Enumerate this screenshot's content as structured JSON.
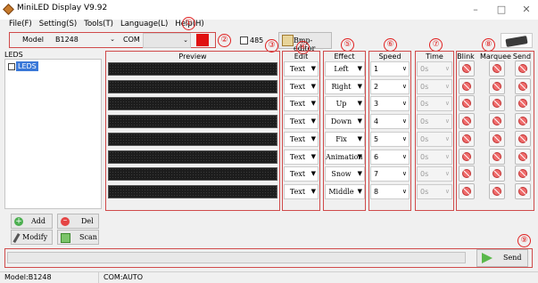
{
  "window": {
    "title": "MiniLED Display V9.92",
    "minimize": "–",
    "maximize": "□",
    "close": "✕"
  },
  "menu": [
    "File(F)",
    "Setting(S)",
    "Tools(T)",
    "Language(L)",
    "Help(H)"
  ],
  "toolbar": {
    "model_label": "Model",
    "model_value": "B1248",
    "com_label": "COM",
    "com_value": "",
    "check485_label": "485",
    "bmp_editor_label": "Bmp-editor"
  },
  "markers": [
    "①",
    "②",
    "③",
    "④",
    "⑤",
    "⑥",
    "⑦",
    "⑧",
    "⑨"
  ],
  "leds": {
    "title": "LEDS",
    "item": "LEDS"
  },
  "headers": {
    "preview": "Preview",
    "edit": "Edit",
    "effect": "Effect",
    "speed": "Speed",
    "time": "Time",
    "blink": "Blink",
    "marquee": "Marquee",
    "send": "Send"
  },
  "rows": [
    {
      "edit": "Text",
      "effect": "Left",
      "speed": "1",
      "time": "0s"
    },
    {
      "edit": "Text",
      "effect": "Right",
      "speed": "2",
      "time": "0s"
    },
    {
      "edit": "Text",
      "effect": "Up",
      "speed": "3",
      "time": "0s"
    },
    {
      "edit": "Text",
      "effect": "Down",
      "speed": "4",
      "time": "0s"
    },
    {
      "edit": "Text",
      "effect": "Fix",
      "speed": "5",
      "time": "0s"
    },
    {
      "edit": "Text",
      "effect": "Animation",
      "speed": "6",
      "time": "0s"
    },
    {
      "edit": "Text",
      "effect": "Snow",
      "speed": "7",
      "time": "0s"
    },
    {
      "edit": "Text",
      "effect": "Middle",
      "speed": "8",
      "time": "0s"
    }
  ],
  "buttons": {
    "add": "Add",
    "del": "Del",
    "modify": "Modify",
    "scan": "Scan",
    "send": "Send"
  },
  "status": {
    "model": "Model:B1248",
    "com": "COM:AUTO"
  },
  "colors": {
    "accent_red": "#e02020",
    "com_swatch": "#e01010",
    "send_icon": "#5ab84a"
  }
}
